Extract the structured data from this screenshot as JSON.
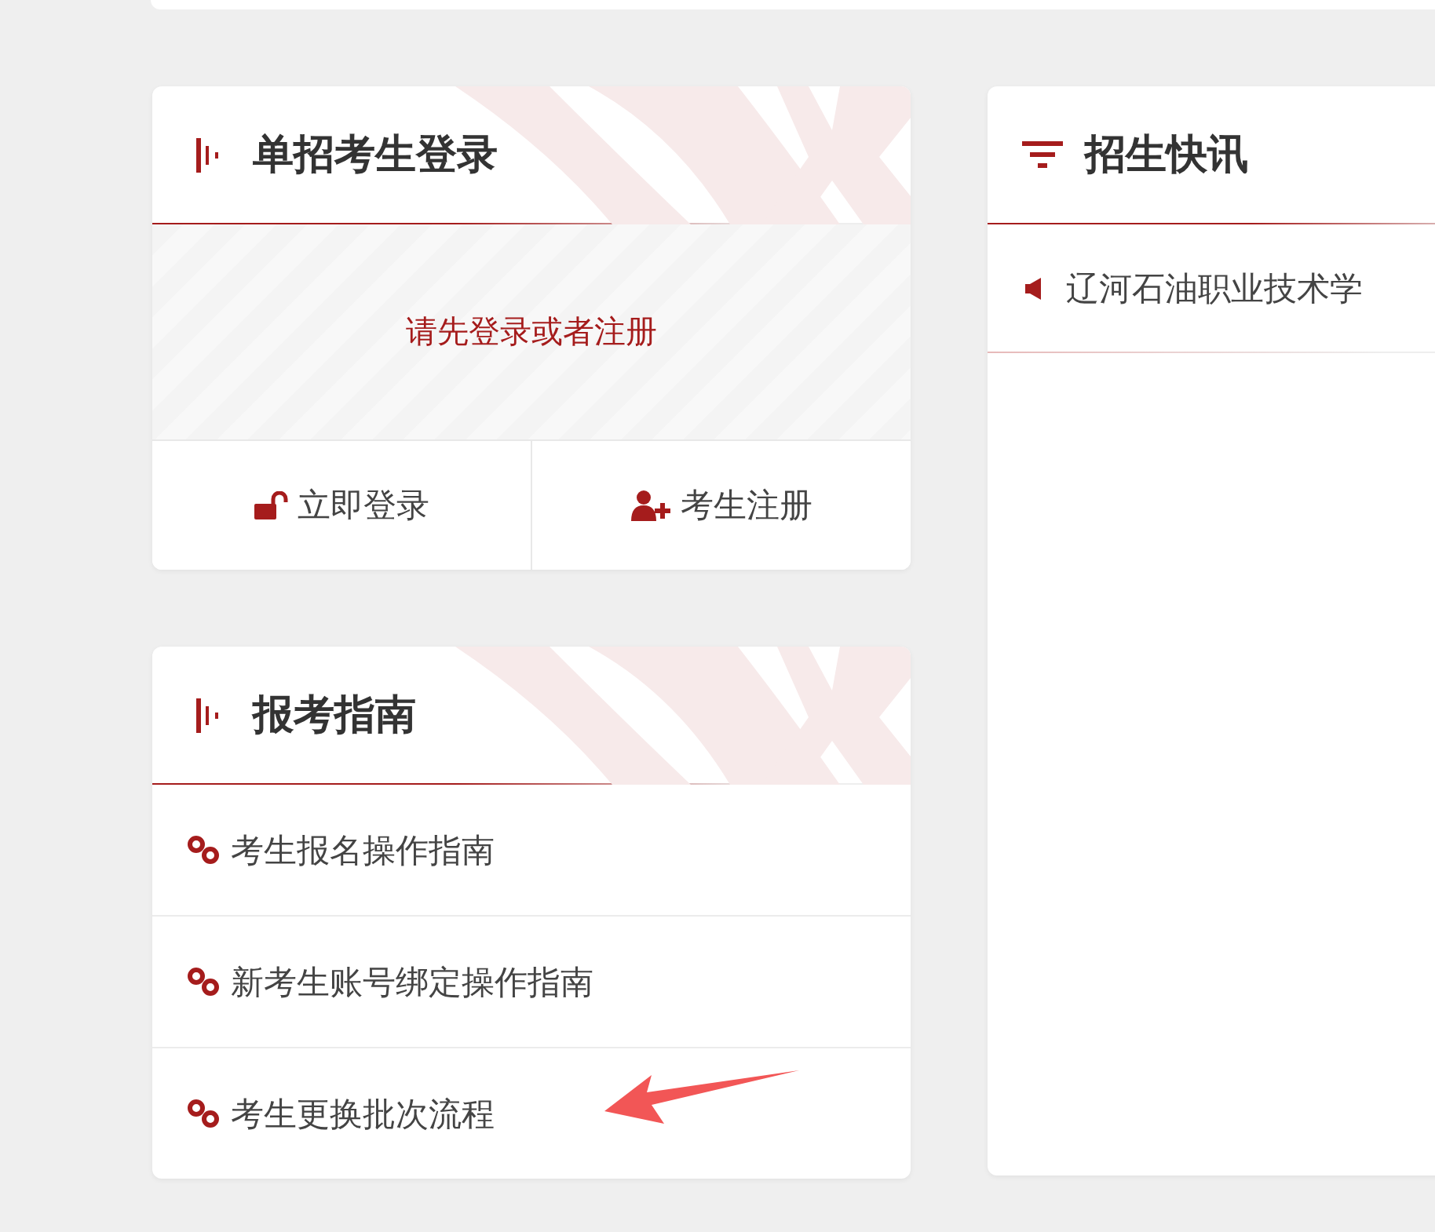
{
  "login_panel": {
    "title": "单招考生登录",
    "prompt": "请先登录或者注册",
    "buttons": [
      {
        "kind": "login",
        "label": "立即登录"
      },
      {
        "kind": "register",
        "label": "考生注册"
      }
    ]
  },
  "guide_panel": {
    "title": "报考指南",
    "links": [
      "考生报名操作指南",
      "新考生账号绑定操作指南",
      "考生更换批次流程"
    ]
  },
  "news_panel": {
    "title": "招生快讯",
    "items": [
      "辽河石油职业技术学"
    ]
  }
}
